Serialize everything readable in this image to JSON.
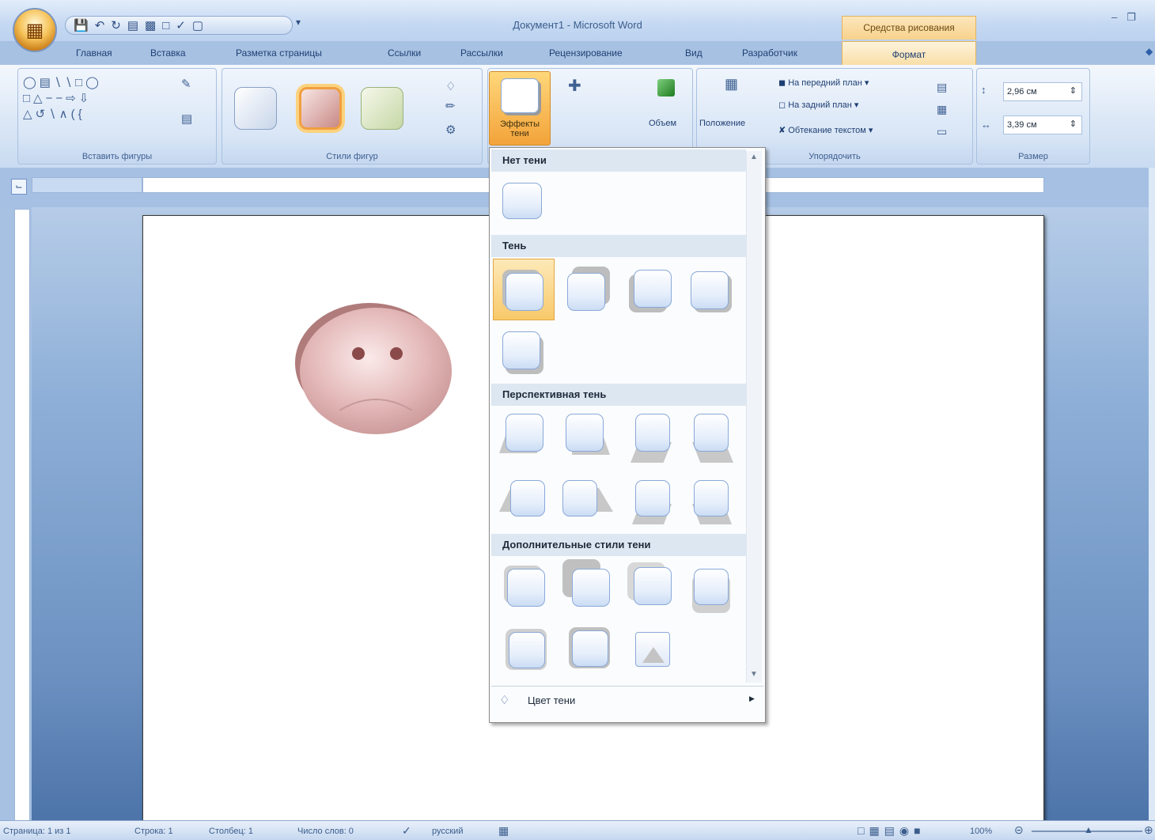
{
  "window": {
    "title": "Документ1 - Microsoft Word",
    "context_tab": "Средства рисования"
  },
  "tabs": [
    {
      "label": "Главная"
    },
    {
      "label": "Вставка"
    },
    {
      "label": "Разметка страницы"
    },
    {
      "label": "Ссылки"
    },
    {
      "label": "Рассылки"
    },
    {
      "label": "Рецензирование"
    },
    {
      "label": "Вид"
    },
    {
      "label": "Разработчик"
    },
    {
      "label": "Формат"
    }
  ],
  "ribbon": {
    "groups": {
      "insert_shapes": "Вставить фигуры",
      "shape_styles": "Стили фигур",
      "arrange": "Упорядочить",
      "size": "Размер"
    },
    "shadow_effects_label": "Эффекты тени",
    "volume_label": "Объем",
    "position_label": "Положение",
    "bring_front": "На передний план",
    "send_back": "На задний план",
    "text_wrap": "Обтекание текстом",
    "height_value": "2,96 см",
    "width_value": "3,39 см"
  },
  "shadow_menu": {
    "no_shadow": "Нет тени",
    "shadow": "Тень",
    "perspective": "Перспективная тень",
    "additional": "Дополнительные стили тени",
    "shadow_color": "Цвет тени"
  },
  "statusbar": {
    "page": "Страница: 1 из 1",
    "line": "Строка: 1",
    "column": "Столбец: 1",
    "words": "Число слов: 0",
    "language": "русский",
    "zoom": "100%"
  }
}
